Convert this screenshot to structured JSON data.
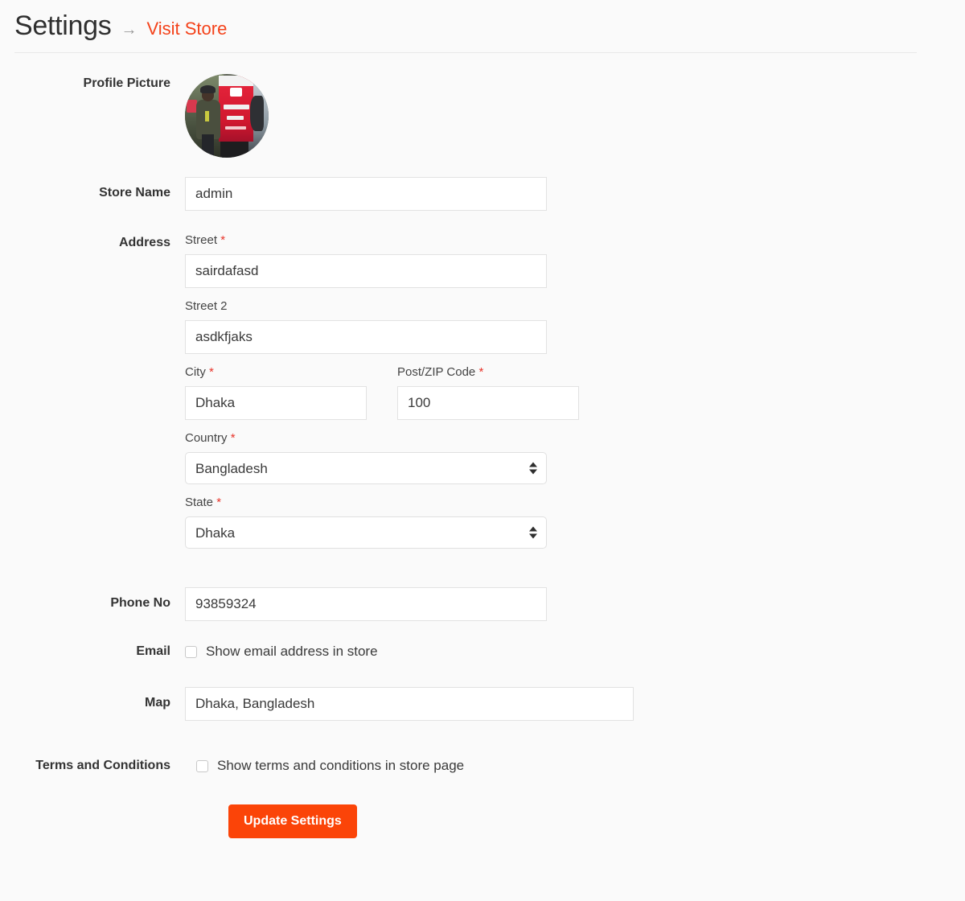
{
  "header": {
    "title": "Settings",
    "arrow": "→",
    "visit_store_label": "Visit Store",
    "link_color": "#f4421a"
  },
  "form": {
    "profile_picture": {
      "label": "Profile Picture",
      "alt": "user profile photo"
    },
    "store_name": {
      "label": "Store Name",
      "value": "admin",
      "placeholder": "Store Name"
    },
    "address": {
      "label": "Address",
      "street": {
        "label": "Street",
        "required": "*",
        "value": "sairdafasd",
        "placeholder": "Street"
      },
      "street2": {
        "label": "Street 2",
        "value": "asdkfjaks",
        "placeholder": "Street 2"
      },
      "city": {
        "label": "City",
        "required": "*",
        "value": "Dhaka",
        "placeholder": "City"
      },
      "zip": {
        "label": "Post/ZIP Code",
        "required": "*",
        "value": "100",
        "placeholder": "Post/ZIP Code"
      },
      "country": {
        "label": "Country",
        "required": "*",
        "selected": "Bangladesh"
      },
      "state": {
        "label": "State",
        "required": "*",
        "selected": "Dhaka"
      }
    },
    "phone": {
      "label": "Phone No",
      "value": "93859324",
      "placeholder": "Phone No"
    },
    "email": {
      "label": "Email",
      "checkbox_label": "Show email address in store",
      "checked": false
    },
    "map": {
      "label": "Map",
      "value": "Dhaka, Bangladesh",
      "placeholder": "Map"
    },
    "terms": {
      "label": "Terms and Conditions",
      "checkbox_label": "Show terms and conditions in store page",
      "checked": false
    },
    "submit": {
      "label": "Update Settings",
      "color": "#fb4408"
    }
  }
}
